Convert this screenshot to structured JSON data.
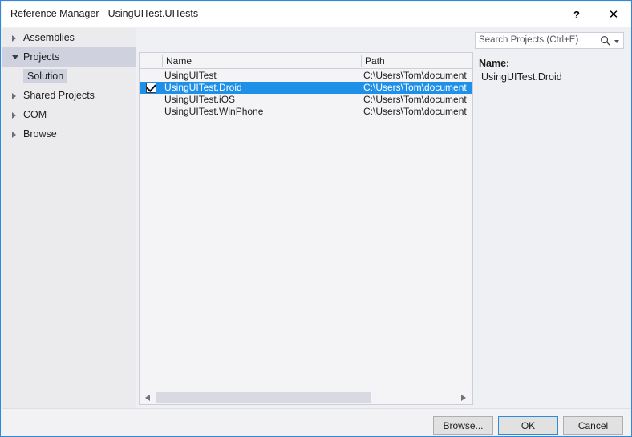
{
  "window": {
    "title": "Reference Manager - UsingUITest.UITests",
    "help_label": "?",
    "close_label": "✕"
  },
  "search": {
    "placeholder": "Search Projects (Ctrl+E)",
    "value": "",
    "icon": "search-icon",
    "dropdown_icon": "chevron-down-icon"
  },
  "sidebar": {
    "items": [
      {
        "label": "Assemblies",
        "expanded": false,
        "selected": false
      },
      {
        "label": "Projects",
        "expanded": true,
        "selected": true
      },
      {
        "label": "Shared Projects",
        "expanded": false,
        "selected": false
      },
      {
        "label": "COM",
        "expanded": false,
        "selected": false
      },
      {
        "label": "Browse",
        "expanded": false,
        "selected": false
      }
    ],
    "child": {
      "label": "Solution",
      "selected": true
    }
  },
  "list": {
    "columns": [
      "Name",
      "Path"
    ],
    "rows": [
      {
        "checked": false,
        "selected": false,
        "name": "UsingUITest",
        "path": "C:\\Users\\Tom\\document"
      },
      {
        "checked": true,
        "selected": true,
        "name": "UsingUITest.Droid",
        "path": "C:\\Users\\Tom\\document"
      },
      {
        "checked": false,
        "selected": false,
        "name": "UsingUITest.iOS",
        "path": "C:\\Users\\Tom\\document"
      },
      {
        "checked": false,
        "selected": false,
        "name": "UsingUITest.WinPhone",
        "path": "C:\\Users\\Tom\\document"
      }
    ]
  },
  "details": {
    "name_label": "Name:",
    "name_value": "UsingUITest.Droid"
  },
  "footer": {
    "browse_label": "Browse...",
    "ok_label": "OK",
    "cancel_label": "Cancel"
  },
  "colors": {
    "selection_blue": "#1e90e8",
    "accent_border": "#2e8ad8",
    "sidebar_bg": "#ebebee",
    "tree_selected": "#cfd1de"
  }
}
